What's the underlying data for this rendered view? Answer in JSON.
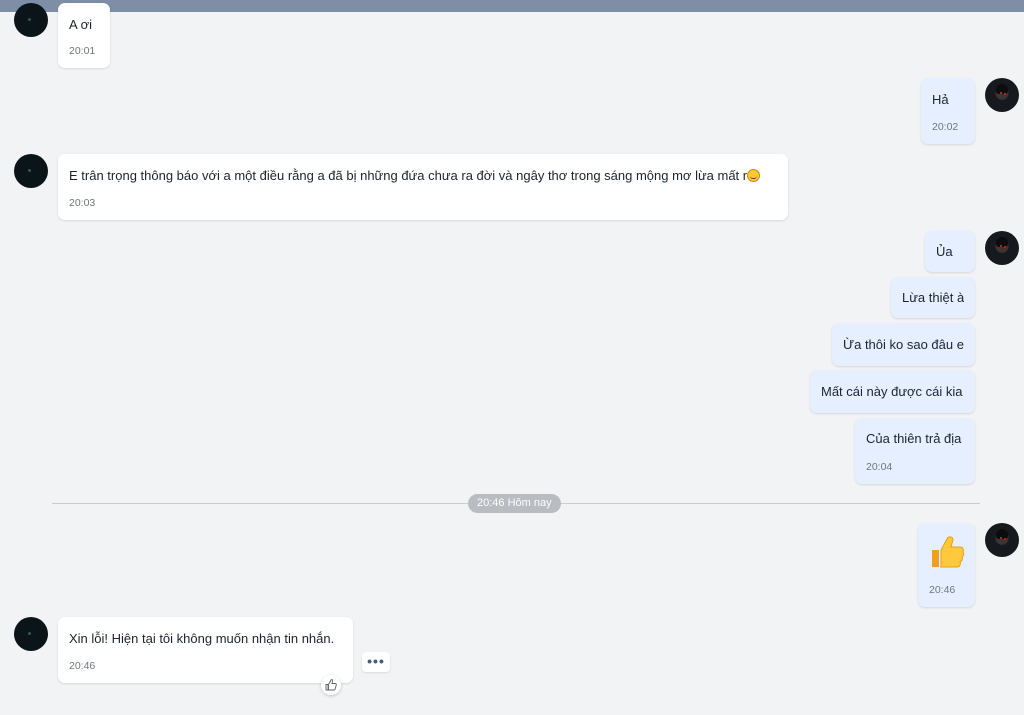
{
  "chat": {
    "messages": [
      {
        "id": "m1",
        "side": "in",
        "text": "A ơi",
        "time": "20:01"
      },
      {
        "id": "m2",
        "side": "out",
        "text": "Hả",
        "time": "20:02"
      },
      {
        "id": "m3",
        "side": "in",
        "text": "E trân trọng thông báo với a một điều rằng a đã bị những đứa chưa ra đời và ngây thơ trong sáng mộng mơ lừa mất r",
        "emoji": "slightly-smiling-face",
        "time": "20:03"
      },
      {
        "id": "m4",
        "side": "out",
        "text": "Ủa"
      },
      {
        "id": "m5",
        "side": "out",
        "text": "Lừa thiệt à"
      },
      {
        "id": "m6",
        "side": "out",
        "text": "Ừa thôi ko sao đâu e"
      },
      {
        "id": "m7",
        "side": "out",
        "text": "Mất cái này được cái kia"
      },
      {
        "id": "m8",
        "side": "out",
        "text": "Của thiên trả địa",
        "time": "20:04"
      },
      {
        "id": "m9",
        "side": "out",
        "sticker": "thumbs-up",
        "time": "20:46"
      },
      {
        "id": "m10",
        "side": "in",
        "text": "Xin lỗi! Hiện tại tôi không muốn nhận tin nhắn.",
        "time": "20:46"
      }
    ],
    "divider": {
      "label": "20:46 Hôm nay"
    }
  },
  "icons": {
    "more": "more-options-icon",
    "react": "thumbs-up-outline-icon",
    "sticker": "thumbs-up-emoji-icon"
  },
  "colors": {
    "outgoing_bubble": "#e5efff",
    "incoming_bubble": "#ffffff",
    "background": "#f2f3f5",
    "topbar": "#7d8ea6"
  }
}
